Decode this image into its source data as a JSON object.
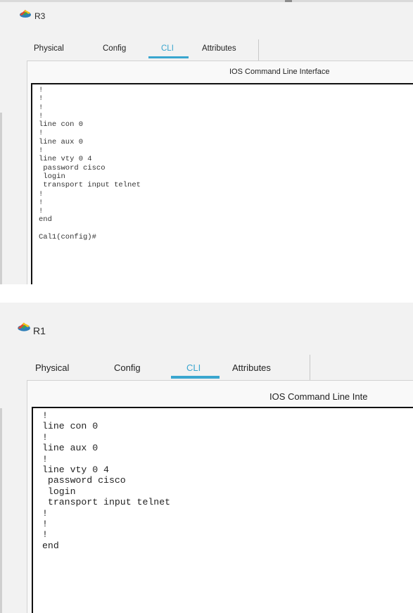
{
  "windows": [
    {
      "title": "R3",
      "icon": "router-icon",
      "tabs": [
        "Physical",
        "Config",
        "CLI",
        "Attributes"
      ],
      "active_tab": "CLI",
      "panel_title": "IOS Command Line Interface",
      "console_lines": [
        "!",
        "!",
        "!",
        "!",
        "line con 0",
        "!",
        "line aux 0",
        "!",
        "line vty 0 4",
        " password cisco",
        " login",
        " transport input telnet",
        "!",
        "!",
        "!",
        "end",
        "",
        "Cal1(config)#"
      ]
    },
    {
      "title": "R1",
      "icon": "router-icon",
      "tabs": [
        "Physical",
        "Config",
        "CLI",
        "Attributes"
      ],
      "active_tab": "CLI",
      "panel_title": "IOS Command Line Inte",
      "console_lines": [
        "!",
        "line con 0",
        "!",
        "line aux 0",
        "!",
        "line vty 0 4",
        " password cisco",
        " login",
        " transport input telnet",
        "!",
        "!",
        "!",
        "end"
      ]
    }
  ],
  "colors": {
    "accent": "#3aa6cf",
    "console_border": "#111111",
    "console_bg": "#ffffff",
    "window_bg": "#f2f2f2"
  }
}
